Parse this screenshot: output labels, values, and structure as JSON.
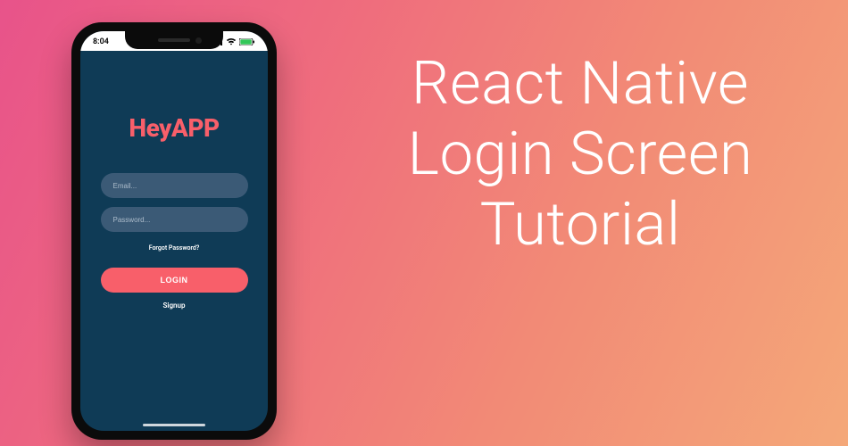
{
  "heading": {
    "line1": "React Native",
    "line2": "Login Screen",
    "line3": "Tutorial"
  },
  "phone": {
    "status": {
      "time": "8:04"
    },
    "app": {
      "logo": "HeyAPP",
      "email_placeholder": "Email...",
      "password_placeholder": "Password...",
      "forgot": "Forgot Password?",
      "login_label": "LOGIN",
      "signup_label": "Signup"
    }
  },
  "colors": {
    "phone_bg": "#0f3b56",
    "accent": "#f85f6a",
    "input_bg": "#3b5a76"
  }
}
